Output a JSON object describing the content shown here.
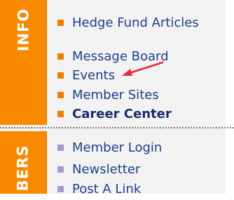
{
  "sidebar": {
    "top_tab_label": "INFO",
    "bottom_tab_label": "BERS",
    "info_items": [
      {
        "label": "Hedge Fund Articles"
      },
      {
        "label": "Message Board"
      },
      {
        "label": "Events"
      },
      {
        "label": "Member Sites"
      },
      {
        "label": "Career Center"
      }
    ],
    "member_items": [
      {
        "label": "Member Login"
      },
      {
        "label": "Newsletter"
      },
      {
        "label": "Post A Link"
      }
    ]
  },
  "colors": {
    "tab_orange": "#f98a00",
    "link_blue": "#1e3f88",
    "bullet_orange": "#f07d00",
    "bullet_lavender": "#9b9fd0",
    "arrow_red": "#e8263c"
  },
  "icons": {
    "info_bullet": "orange-square-bullet-icon",
    "member_bullet": "lavender-square-bullet-icon",
    "annotation": "red-arrow-icon"
  }
}
